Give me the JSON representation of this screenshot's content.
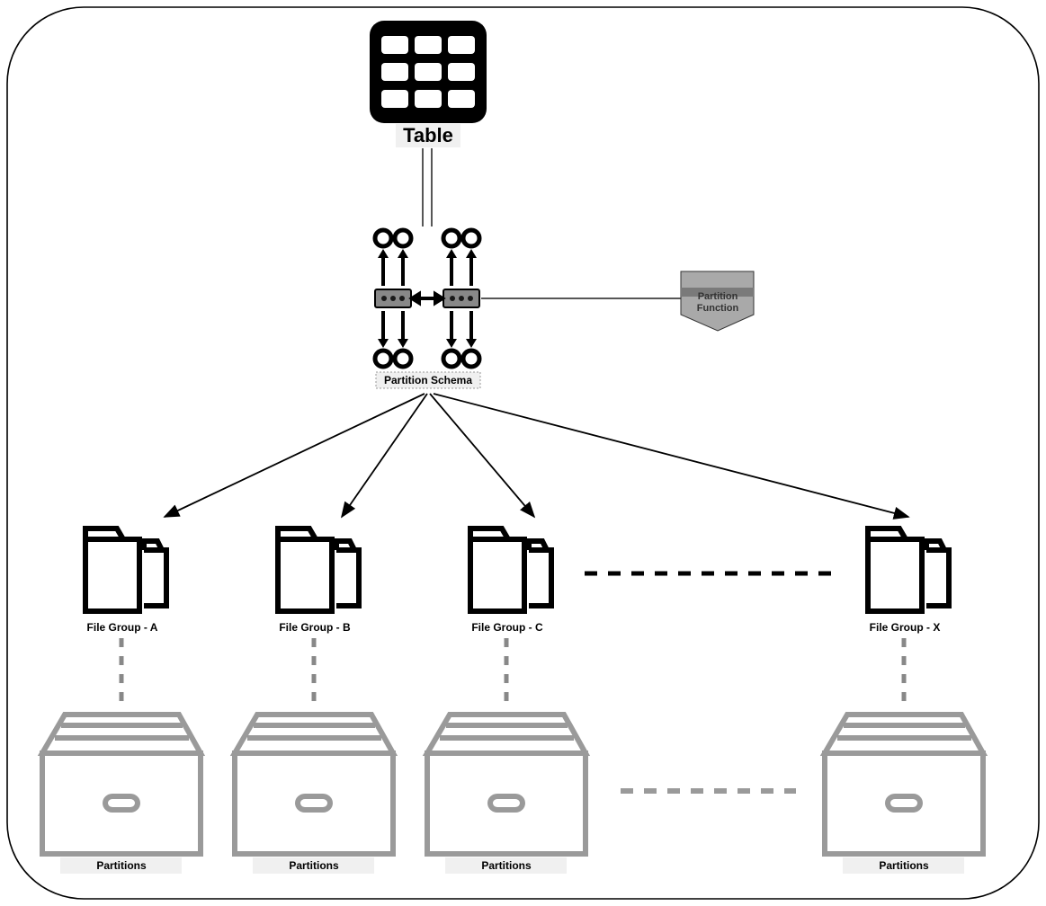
{
  "title": "Table",
  "partition_schema_label": "Partition Schema",
  "partition_function_label_line1": "Partition",
  "partition_function_label_line2": "Function",
  "filegroups": {
    "a": "File Group - A",
    "b": "File Group - B",
    "c": "File Group - C",
    "x": "File Group - X"
  },
  "partitions_label": "Partitions"
}
